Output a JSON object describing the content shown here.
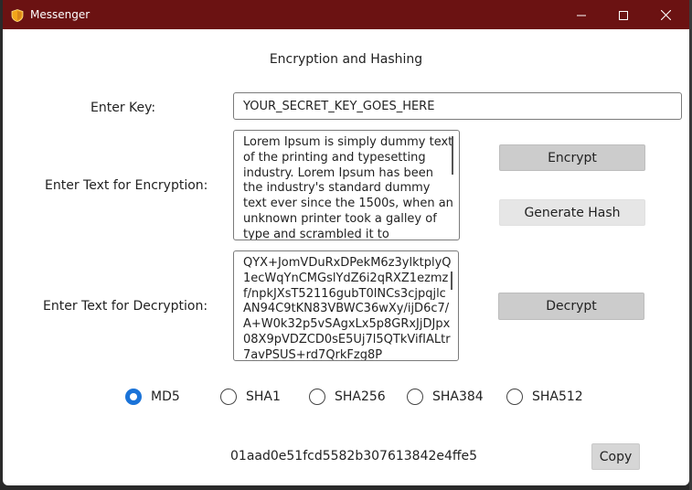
{
  "window": {
    "title": "Messenger",
    "icon": "shield-icon"
  },
  "titlebar": {
    "minimize_icon": "minimize-icon",
    "maximize_icon": "maximize-icon",
    "close_icon": "close-icon",
    "color": "#6b1212"
  },
  "main": {
    "heading": "Encryption and Hashing",
    "key_label": "Enter Key:",
    "key_value": "YOUR_SECRET_KEY_GOES_HERE",
    "enc_label": "Enter Text for Encryption:",
    "enc_text": "Lorem Ipsum is simply dummy text of the printing and typesetting industry. Lorem Ipsum has been the industry's standard dummy text ever since the 1500s, when an unknown printer took a galley of type and scrambled it to",
    "dec_label": "Enter Text for Decryption:",
    "dec_text": "QYX+JomVDuRxDPekM6z3ylktplyQ1ecWqYnCMGslYdZ6i2qRXZ1ezmzf/npkJXsT52116gubT0lNCs3cjpqjlcAN94C9tKN83VBWC36wXy/ijD6c7/A+W0k32p5vSAgxLx5p8GRxJjDJpx08X9pVDZCD0sE5Uj7l5QTkVifIALtr7avPSUS+rd7QrkFzg8P",
    "encrypt_label": "Encrypt",
    "hash_label": "Generate Hash",
    "decrypt_label": "Decrypt",
    "copy_label": "Copy",
    "hash_output": "01aad0e51fcd5582b307613842e4ffe5"
  },
  "hash_options": [
    {
      "label": "MD5",
      "selected": true
    },
    {
      "label": "SHA1",
      "selected": false
    },
    {
      "label": "SHA256",
      "selected": false
    },
    {
      "label": "SHA384",
      "selected": false
    },
    {
      "label": "SHA512",
      "selected": false
    }
  ],
  "colors": {
    "radio_selected": "#1a73d8",
    "button": "#cccccc"
  }
}
